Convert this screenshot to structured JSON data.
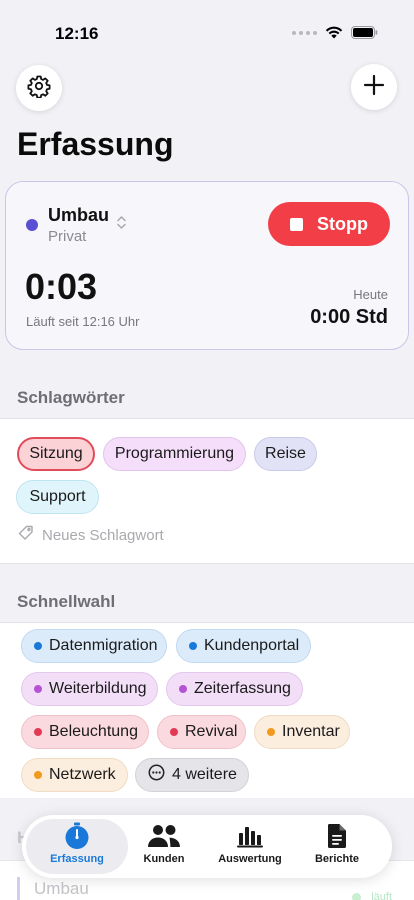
{
  "status_bar": {
    "time": "12:16"
  },
  "page": {
    "title": "Erfassung"
  },
  "timer": {
    "project_name": "Umbau",
    "project_client": "Privat",
    "project_color": "#5a4fd3",
    "stop_label": "Stopp",
    "elapsed": "0:03",
    "since": "Läuft seit 12:16 Uhr",
    "today_label": "Heute",
    "today_value": "0:00 Std"
  },
  "tags": {
    "header": "Schlagwörter",
    "items": [
      {
        "label": "Sitzung",
        "selected": true
      },
      {
        "label": "Programmierung",
        "selected": false
      },
      {
        "label": "Reise",
        "selected": false
      },
      {
        "label": "Support",
        "selected": false
      }
    ],
    "new_tag_placeholder": "Neues Schlagwort"
  },
  "quick": {
    "header": "Schnellwahl",
    "items": [
      {
        "label": "Datenmigration",
        "color": "#1a78d8"
      },
      {
        "label": "Kundenportal",
        "color": "#1a78d8"
      },
      {
        "label": "Weiterbildung",
        "color": "#b454d4"
      },
      {
        "label": "Zeiterfassung",
        "color": "#b454d4"
      },
      {
        "label": "Beleuchtung",
        "color": "#e23a55"
      },
      {
        "label": "Revival",
        "color": "#e23a55"
      },
      {
        "label": "Inventar",
        "color": "#f29a1e"
      },
      {
        "label": "Netzwerk",
        "color": "#f29a1e"
      }
    ],
    "more_label": "4 weitere"
  },
  "history": {
    "header": "Heute",
    "first_entry": "Umbau",
    "first_entry_status": "läuft"
  },
  "tab_bar": {
    "tabs": [
      {
        "label": "Erfassung",
        "icon": "stopwatch-icon",
        "active": true
      },
      {
        "label": "Kunden",
        "icon": "people-icon",
        "active": false
      },
      {
        "label": "Auswertung",
        "icon": "bar-chart-icon",
        "active": false
      },
      {
        "label": "Berichte",
        "icon": "document-icon",
        "active": false
      }
    ]
  }
}
